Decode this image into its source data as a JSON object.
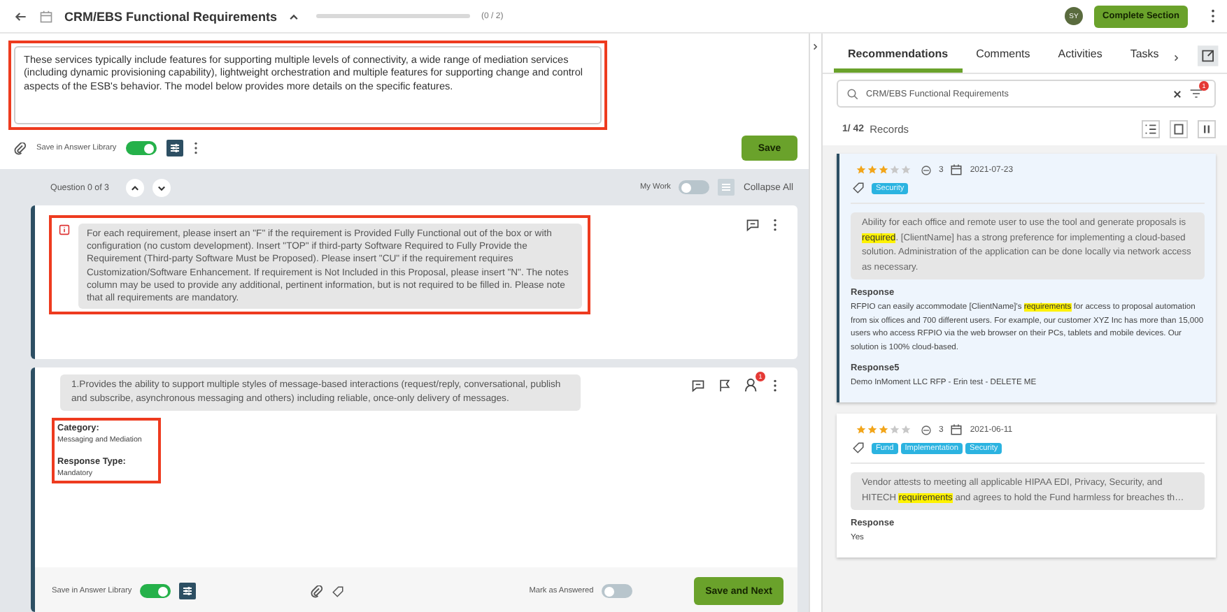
{
  "header": {
    "title": "CRM/EBS Functional Requirements",
    "progress": {
      "level": 0,
      "reading": "(0 / 2)"
    },
    "avatar": "SY",
    "complete_button": "Complete Section"
  },
  "section": {
    "text": "These services typically include features for supporting multiple levels of connectivity, a wide range of mediation services (including dynamic provisioning capability), lightweight orchestration and multiple features for supporting change and control aspects of the ESB's behavior. The model below provides more details on the specific features.",
    "save_library_label": "Save in Answer Library",
    "save_library_on": true,
    "save_button": "Save"
  },
  "question_nav": {
    "label": "Question 0 of 3",
    "my_work_label": "My Work",
    "my_work_on": false,
    "collapse_all": "Collapse All"
  },
  "instruction": {
    "text": "For each requirement, please insert an \"F\" if the requirement is Provided Fully Functional out of the box or with configuration (no custom development). Insert \"TOP\" if third-party Software Required to Fully Provide the Requirement (Third-party Software Must be Proposed). Please insert \"CU\" if the requirement requires Customization/Software Enhancement. If requirement is Not Included in this Proposal, please insert \"N\". The notes column may be used to provide any additional, pertinent information, but is not required to be filled in. Please note that all requirements are mandatory."
  },
  "question": {
    "number": "1.",
    "text": "Provides the ability to support multiple styles of message-based interactions (request/reply, conversational, publish and subscribe, asynchronous messaging and others) including reliable, once-only delivery of messages.",
    "assignee_badge": "1",
    "fields": [
      {
        "label": "Category:",
        "value": "Messaging and Mediation"
      },
      {
        "label": "Response Type:",
        "value": "Mandatory"
      }
    ],
    "save_library_label": "Save in Answer Library",
    "save_library_on": true,
    "mark_answered_label": "Mark as Answered",
    "mark_answered_on": false,
    "save_next_button": "Save and Next"
  },
  "side": {
    "tabs": [
      {
        "label": "Recommendations",
        "selected": true
      },
      {
        "label": "Comments",
        "selected": false
      },
      {
        "label": "Activities",
        "selected": false
      },
      {
        "label": "Tasks",
        "selected": false
      }
    ],
    "search": {
      "value": "CRM/EBS Functional Requirements",
      "filter_badge": "1"
    },
    "records_count": "1/ 42",
    "records_label": "Records",
    "records": [
      {
        "selected": true,
        "stars": 3,
        "uses": "3",
        "date": "2021-07-23",
        "tags": [
          "Security"
        ],
        "question": [
          {
            "text": "Ability for each office and remote user to use the tool and generate proposals is ",
            "highlight": false
          },
          {
            "text": "required",
            "highlight": true
          },
          {
            "text": ". [ClientName] has a strong preference for implementing a cloud-based solution. Administration of the application can be done locally via network access as necessary.",
            "highlight": false
          }
        ],
        "responses": [
          {
            "label": "Response",
            "text": [
              {
                "text": "RFPIO can easily accommodate [ClientName]'s ",
                "highlight": false
              },
              {
                "text": "requirements",
                "highlight": true
              },
              {
                "text": " for access to proposal automation from six offices and 700 different users. For example, our customer XYZ Inc has more than 15,000 users who access RFPIO via the web browser on their PCs, tablets and mobile devices. Our solution is 100% cloud-based.",
                "highlight": false
              }
            ]
          },
          {
            "label": "Response5",
            "text": [
              {
                "text": "Demo InMoment LLC RFP - Erin test - DELETE ME",
                "highlight": false
              }
            ]
          }
        ]
      },
      {
        "selected": false,
        "stars": 3,
        "uses": "3",
        "date": "2021-06-11",
        "tags": [
          "Fund",
          "Implementation",
          "Security"
        ],
        "question": [
          {
            "text": "Vendor attests to meeting all applicable HIPAA EDI, Privacy, Security, and HITECH ",
            "highlight": false
          },
          {
            "text": "requirements",
            "highlight": true
          },
          {
            "text": " and agrees to hold the Fund harmless for breaches th…",
            "highlight": false
          }
        ],
        "responses": [
          {
            "label": "Response",
            "text": [
              {
                "text": "Yes",
                "highlight": false
              }
            ]
          }
        ]
      }
    ]
  }
}
